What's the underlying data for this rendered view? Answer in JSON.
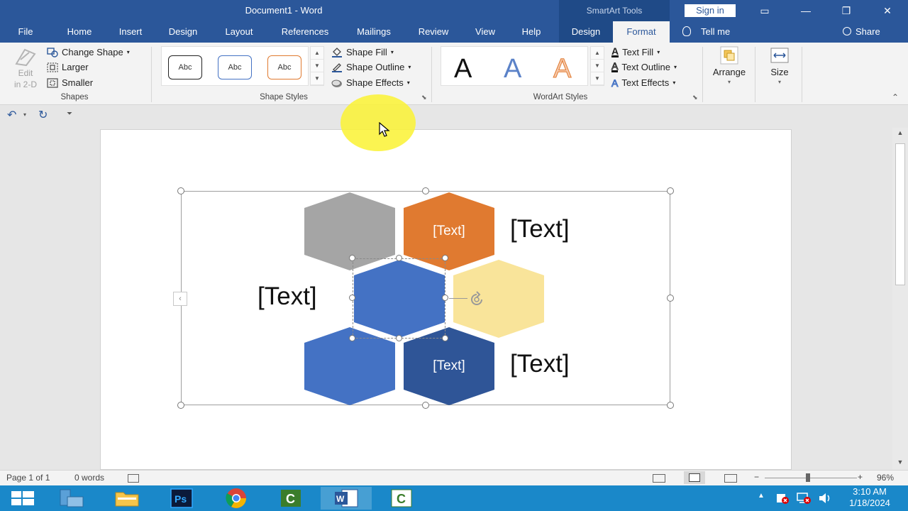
{
  "titlebar": {
    "doc_title": "Document1  -  Word",
    "context_title": "SmartArt Tools",
    "sign_in": "Sign in",
    "ribbon_display_glyph": "▭",
    "minimize_glyph": "—",
    "restore_glyph": "❐",
    "close_glyph": "✕"
  },
  "tabs": {
    "file": "File",
    "home": "Home",
    "insert": "Insert",
    "design": "Design",
    "layout": "Layout",
    "references": "References",
    "mailings": "Mailings",
    "review": "Review",
    "view": "View",
    "help": "Help",
    "sa_design": "Design",
    "sa_format": "Format",
    "tell_me": "Tell me",
    "share": "Share"
  },
  "ribbon": {
    "shapes": {
      "edit_2d_line1": "Edit",
      "edit_2d_line2": "in 2-D",
      "change_shape": "Change Shape",
      "larger": "Larger",
      "smaller": "Smaller",
      "label": "Shapes"
    },
    "shape_styles": {
      "preset_1": "Abc",
      "preset_2": "Abc",
      "preset_3": "Abc",
      "shape_fill": "Shape Fill",
      "shape_outline": "Shape Outline",
      "shape_effects": "Shape Effects",
      "label": "Shape Styles"
    },
    "wordart_styles": {
      "preset_1": "A",
      "preset_2": "A",
      "preset_3": "A",
      "text_fill": "Text Fill",
      "text_outline": "Text Outline",
      "text_effects": "Text Effects",
      "label": "WordArt Styles"
    },
    "arrange": {
      "label": "Arrange"
    },
    "size": {
      "label": "Size"
    }
  },
  "qat": {
    "undo_glyph": "↶",
    "redo_glyph": "↻",
    "customize_glyph": "⏷"
  },
  "smartart": {
    "hex_orange": "[Text]",
    "hex_navy": "[Text]",
    "label_top_right": "[Text]",
    "label_mid_left": "[Text]",
    "label_bottom_right": "[Text]",
    "collapse_glyph": "‹"
  },
  "colors": {
    "accent": "#2b579a",
    "hex_gray": "#a5a5a5",
    "hex_orange": "#e07a30",
    "hex_blue": "#4472c4",
    "hex_light_yellow": "#f9e49a",
    "hex_navy": "#2f5597"
  },
  "statusbar": {
    "page": "Page 1 of 1",
    "words": "0 words",
    "zoom": "96%"
  },
  "taskbar": {
    "time": "3:10 AM",
    "date": "1/18/2024"
  }
}
